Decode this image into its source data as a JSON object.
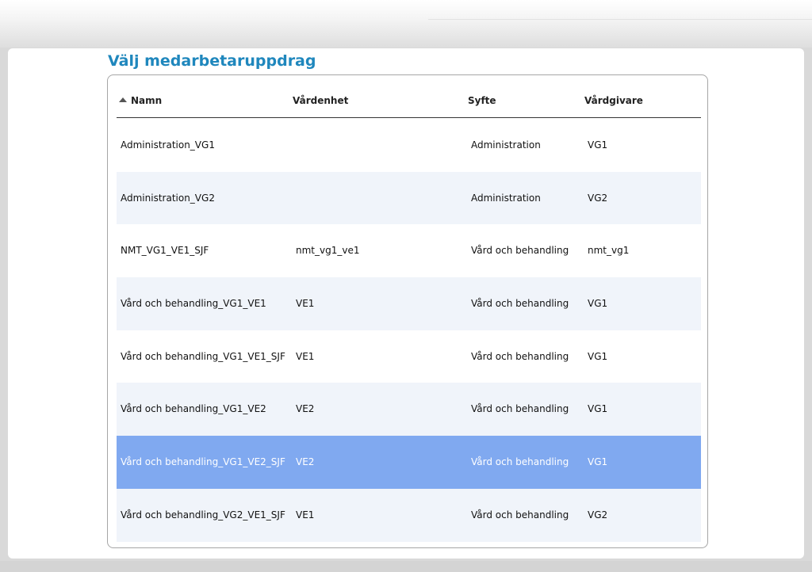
{
  "page": {
    "title": "Välj medarbetaruppdrag"
  },
  "table": {
    "columns": [
      {
        "label": "Namn",
        "sorted": "ascending"
      },
      {
        "label": "Vårdenhet"
      },
      {
        "label": "Syfte"
      },
      {
        "label": "Vårdgivare"
      }
    ],
    "rows": [
      {
        "namn": "Administration_VG1",
        "vardenhet": "",
        "syfte": "Administration",
        "vardgivare": "VG1",
        "selected": false
      },
      {
        "namn": "Administration_VG2",
        "vardenhet": "",
        "syfte": "Administration",
        "vardgivare": "VG2",
        "selected": false
      },
      {
        "namn": "NMT_VG1_VE1_SJF",
        "vardenhet": "nmt_vg1_ve1",
        "syfte": "Vård och behandling",
        "vardgivare": "nmt_vg1",
        "selected": false
      },
      {
        "namn": "Vård och behandling_VG1_VE1",
        "vardenhet": "VE1",
        "syfte": "Vård och behandling",
        "vardgivare": "VG1",
        "selected": false
      },
      {
        "namn": "Vård och behandling_VG1_VE1_SJF",
        "vardenhet": "VE1",
        "syfte": "Vård och behandling",
        "vardgivare": "VG1",
        "selected": false
      },
      {
        "namn": "Vård och behandling_VG1_VE2",
        "vardenhet": "VE2",
        "syfte": "Vård och behandling",
        "vardgivare": "VG1",
        "selected": false
      },
      {
        "namn": "Vård och behandling_VG1_VE2_SJF",
        "vardenhet": "VE2",
        "syfte": "Vård och behandling",
        "vardgivare": "VG1",
        "selected": true
      },
      {
        "namn": "Vård och behandling_VG2_VE1_SJF",
        "vardenhet": "VE1",
        "syfte": "Vård och behandling",
        "vardgivare": "VG2",
        "selected": false
      }
    ]
  },
  "colors": {
    "title": "#1f87bd",
    "row_alt": "#f0f4fa",
    "row_selected": "#80a9f0"
  }
}
